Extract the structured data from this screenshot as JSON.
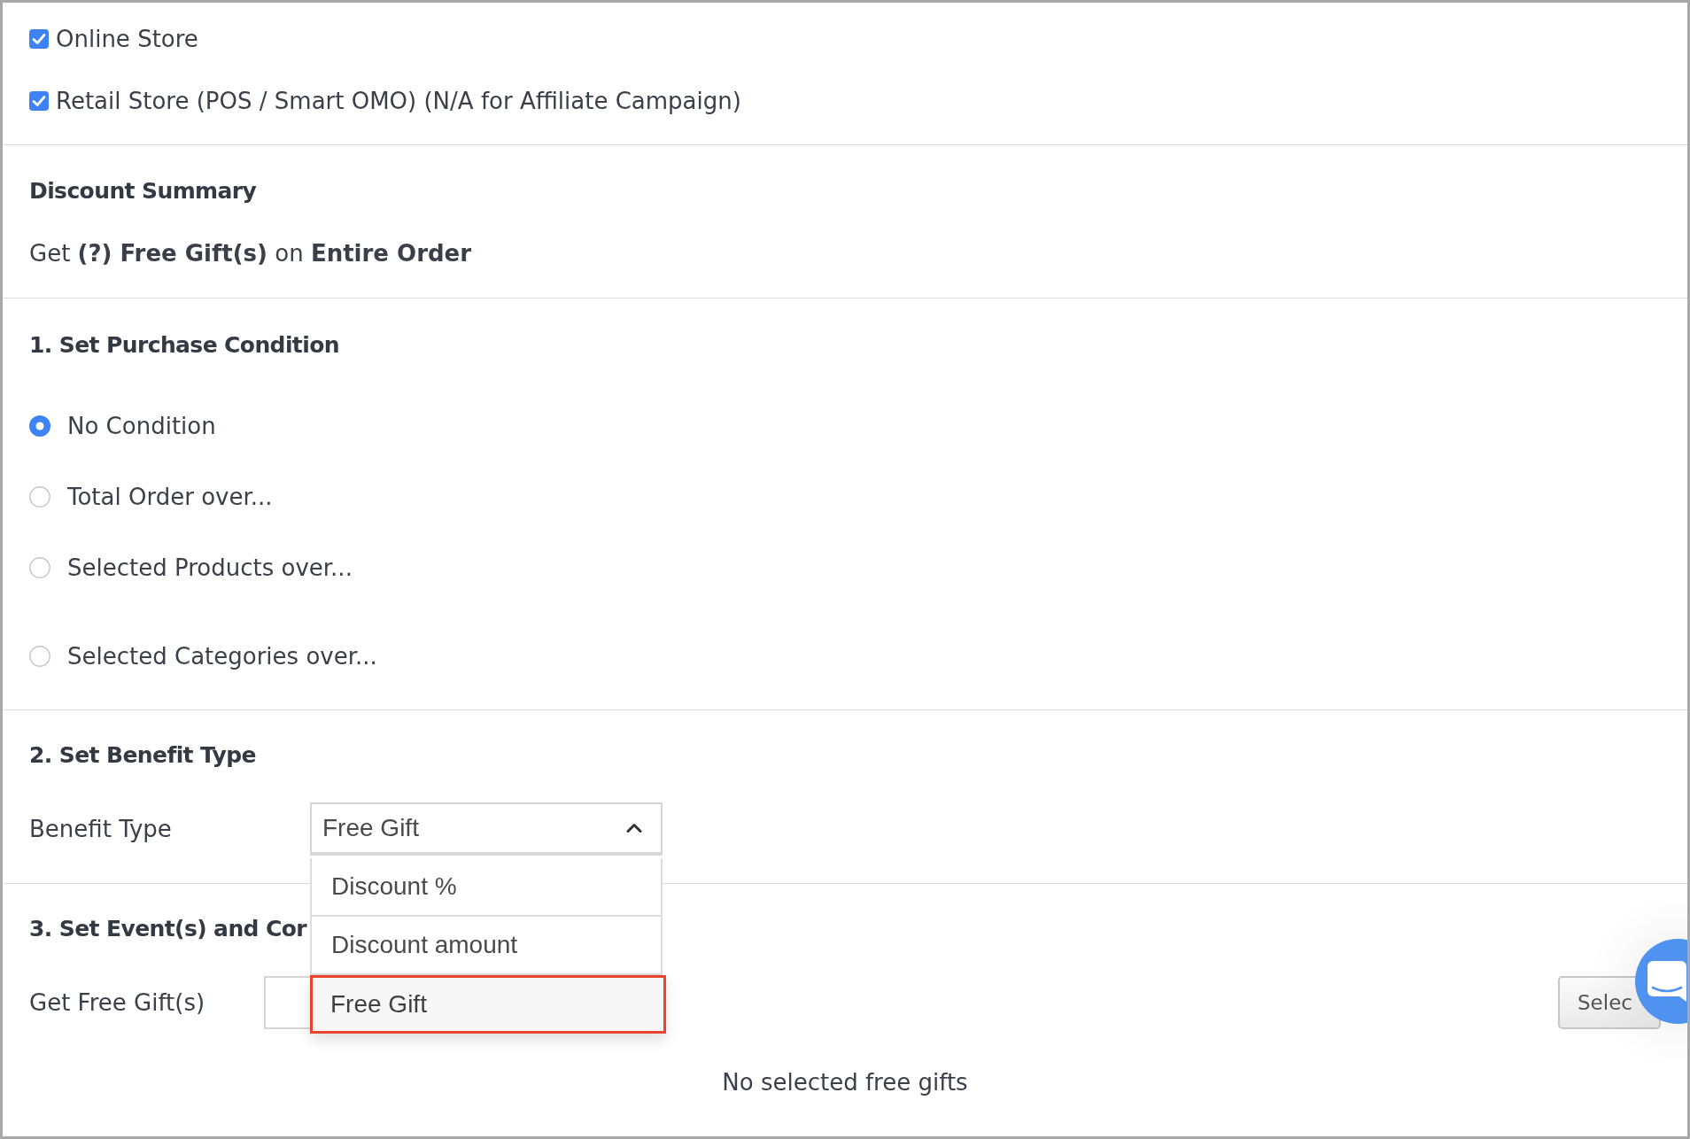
{
  "channels": [
    {
      "label": "Online Store",
      "checked": true
    },
    {
      "label": "Retail Store (POS / Smart OMO) (N/A for Affiliate Campaign)",
      "checked": true
    }
  ],
  "discount_summary": {
    "title": "Discount Summary",
    "text": "Get **(?) Free Gift(s)** on **Entire Order**"
  },
  "purchase_condition": {
    "title": "1. Set Purchase Condition",
    "options": [
      {
        "label": "No Condition",
        "selected": true
      },
      {
        "label": "Total Order over...",
        "selected": false
      },
      {
        "label": "Selected Products over...",
        "selected": false
      },
      {
        "label": "Selected Categories over...",
        "selected": false
      }
    ]
  },
  "benefit_type": {
    "title": "2. Set Benefit Type",
    "label": "Benefit Type",
    "value": "Free Gift",
    "expanded": true,
    "options": [
      {
        "label": "Discount %",
        "selected": false
      },
      {
        "label": "Discount amount",
        "selected": false
      },
      {
        "label": "Free Gift",
        "selected": true
      }
    ]
  },
  "events": {
    "title": "3. Set Event(s) and Cor",
    "field_label": "Get Free Gift(s)",
    "button": "Selec",
    "empty_text": "No selected free gifts"
  }
}
